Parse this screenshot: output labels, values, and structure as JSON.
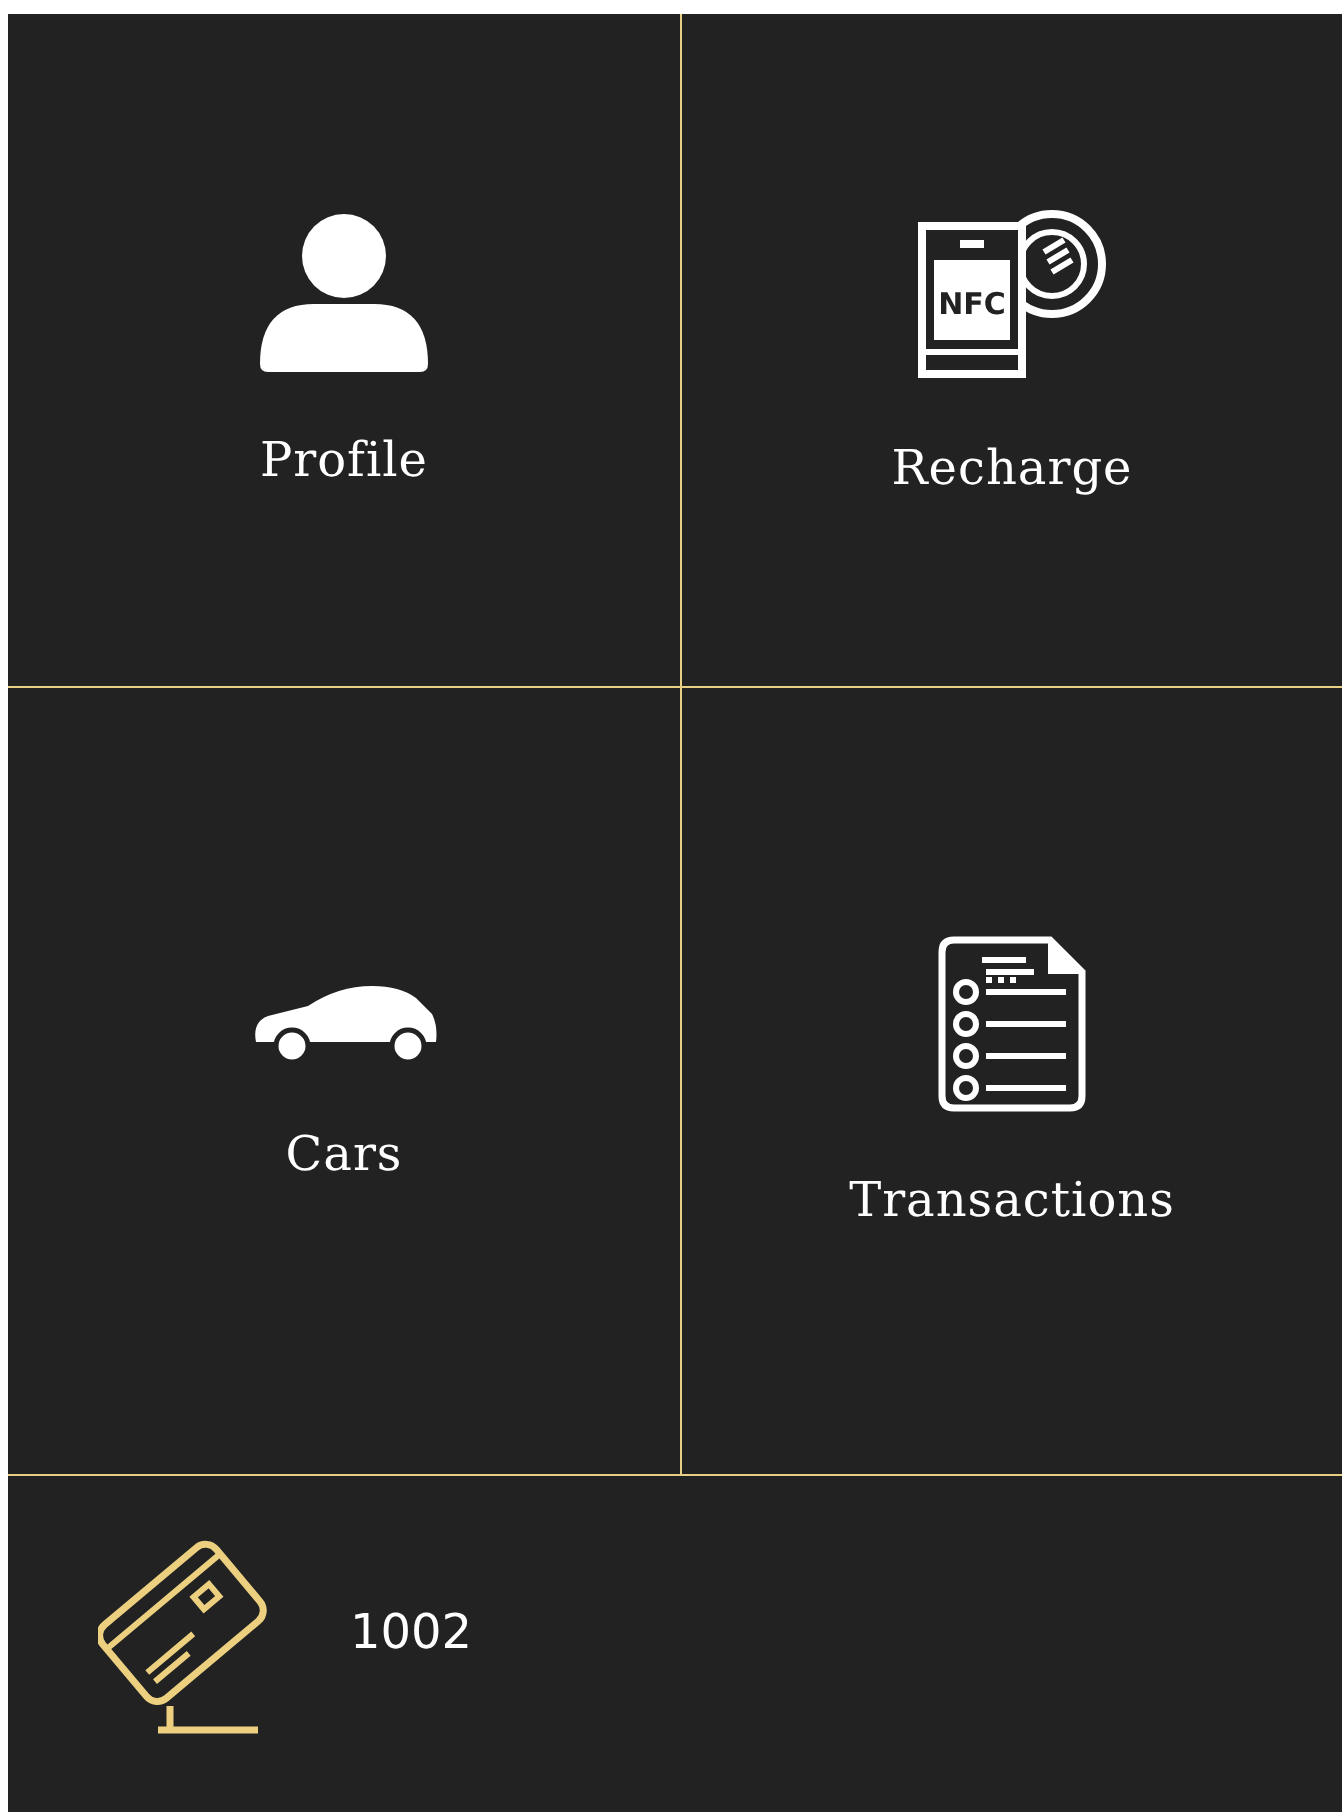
{
  "tiles": [
    {
      "kind": "profile",
      "label": "Profile"
    },
    {
      "kind": "recharge",
      "label": "Recharge",
      "icon_text": "NFC"
    },
    {
      "kind": "cars",
      "label": "Cars"
    },
    {
      "kind": "transactions",
      "label": "Transactions"
    }
  ],
  "card": {
    "number": "1002"
  }
}
